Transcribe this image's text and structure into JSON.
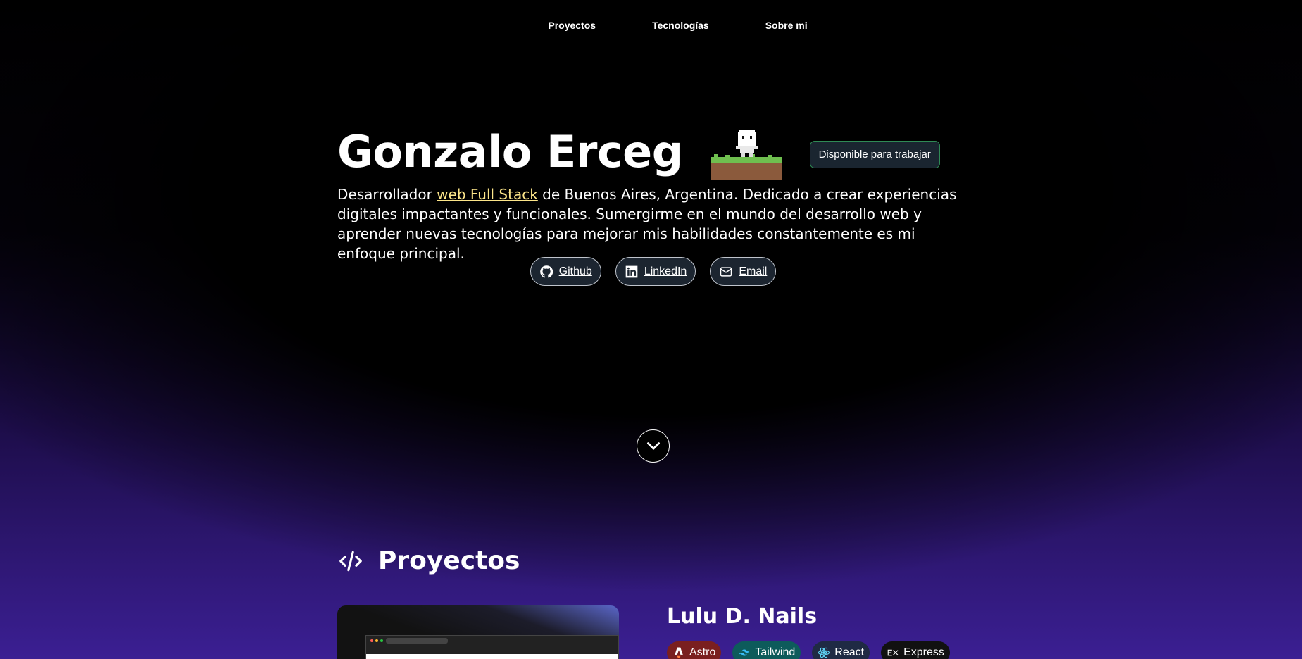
{
  "nav": {
    "items": [
      {
        "label": "Proyectos"
      },
      {
        "label": "Tecnologías"
      },
      {
        "label": "Sobre mi"
      }
    ]
  },
  "hero": {
    "name": "Gonzalo Erceg",
    "badge": "Disponible para trabajar",
    "desc_prefix": "Desarrollador ",
    "desc_highlight": "web Full Stack",
    "desc_rest": " de Buenos Aires, Argentina. Dedicado a crear experiencias digitales impactantes y funcionales. Sumergirme en el mundo del desarrollo web y aprender nuevas tecnologías para mejorar mis habilidades constantemente es mi enfoque principal."
  },
  "socials": [
    {
      "label": "Github",
      "icon": "github-icon"
    },
    {
      "label": "LinkedIn",
      "icon": "linkedin-icon"
    },
    {
      "label": "Email",
      "icon": "mail-icon"
    }
  ],
  "projects": {
    "heading": "Proyectos",
    "first": {
      "title": "Lulu D. Nails",
      "tags": [
        {
          "label": "Astro",
          "color": "#7a1f1f"
        },
        {
          "label": "Tailwind",
          "color": "#0d5b5b"
        },
        {
          "label": "React",
          "color": "#1f2a44"
        },
        {
          "label": "Express",
          "color": "#111111"
        }
      ]
    }
  },
  "colors": {
    "accent_highlight": "#fde68a",
    "badge_border": "#2f8a55"
  }
}
